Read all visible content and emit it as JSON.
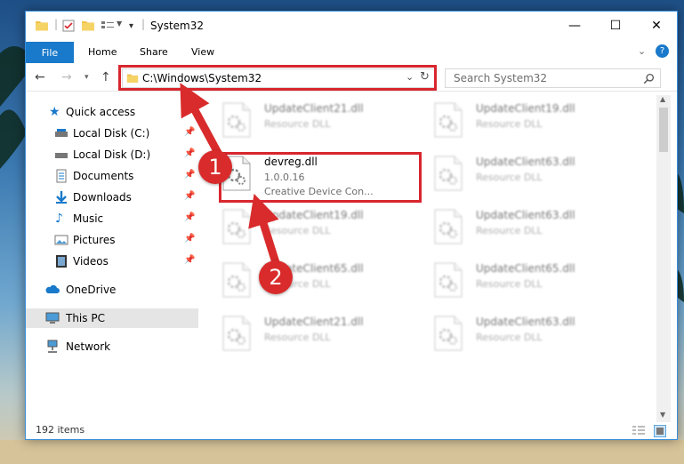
{
  "window": {
    "title": "System32",
    "controls": {
      "minimize": "—",
      "maximize": "☐",
      "close": "✕"
    }
  },
  "ribbon": {
    "tabs": [
      "File",
      "Home",
      "Share",
      "View"
    ],
    "help": "?"
  },
  "addressbar": {
    "path": "C:\\Windows\\System32",
    "search_placeholder": "Search System32"
  },
  "nav": {
    "items": [
      {
        "label": "Quick access",
        "icon": "star-icon"
      },
      {
        "label": "Local Disk (C:)",
        "icon": "drive-icon",
        "pinned": true
      },
      {
        "label": "Local Disk (D:)",
        "icon": "drive-icon",
        "pinned": true
      },
      {
        "label": "Documents",
        "icon": "documents-icon",
        "pinned": true
      },
      {
        "label": "Downloads",
        "icon": "download-icon",
        "pinned": true
      },
      {
        "label": "Music",
        "icon": "music-icon",
        "pinned": true
      },
      {
        "label": "Pictures",
        "icon": "pictures-icon",
        "pinned": true
      },
      {
        "label": "Videos",
        "icon": "videos-icon",
        "pinned": true
      },
      {
        "label": "OneDrive",
        "icon": "cloud-icon"
      },
      {
        "label": "This PC",
        "icon": "computer-icon",
        "selected": true
      },
      {
        "label": "Network",
        "icon": "network-icon"
      }
    ]
  },
  "files": [
    {
      "name": "UpdateClient21.dll",
      "line1": "Resource DLL",
      "line2": ""
    },
    {
      "name": "UpdateClient19.dll",
      "line1": "Resource DLL",
      "line2": ""
    },
    {
      "name": "devreg.dll",
      "line1": "1.0.0.16",
      "line2": "Creative Device Con...",
      "highlighted": true
    },
    {
      "name": "UpdateClient63.dll",
      "line1": "Resource DLL",
      "line2": ""
    },
    {
      "name": "UpdateClient19.dll",
      "line1": "Resource DLL",
      "line2": ""
    },
    {
      "name": "UpdateClient63.dll",
      "line1": "Resource DLL",
      "line2": ""
    },
    {
      "name": "UpdateClient65.dll",
      "line1": "Resource DLL",
      "line2": ""
    },
    {
      "name": "UpdateClient65.dll",
      "line1": "Resource DLL",
      "line2": ""
    },
    {
      "name": "UpdateClient21.dll",
      "line1": "Resource DLL",
      "line2": ""
    },
    {
      "name": "UpdateClient63.dll",
      "line1": "Resource DLL",
      "line2": ""
    }
  ],
  "status": {
    "item_count": "192 items"
  },
  "annotations": [
    {
      "label": "1"
    },
    {
      "label": "2"
    }
  ],
  "colors": {
    "accent": "#1979ca",
    "highlight": "#d8262e",
    "badge": "#d92b2b"
  }
}
